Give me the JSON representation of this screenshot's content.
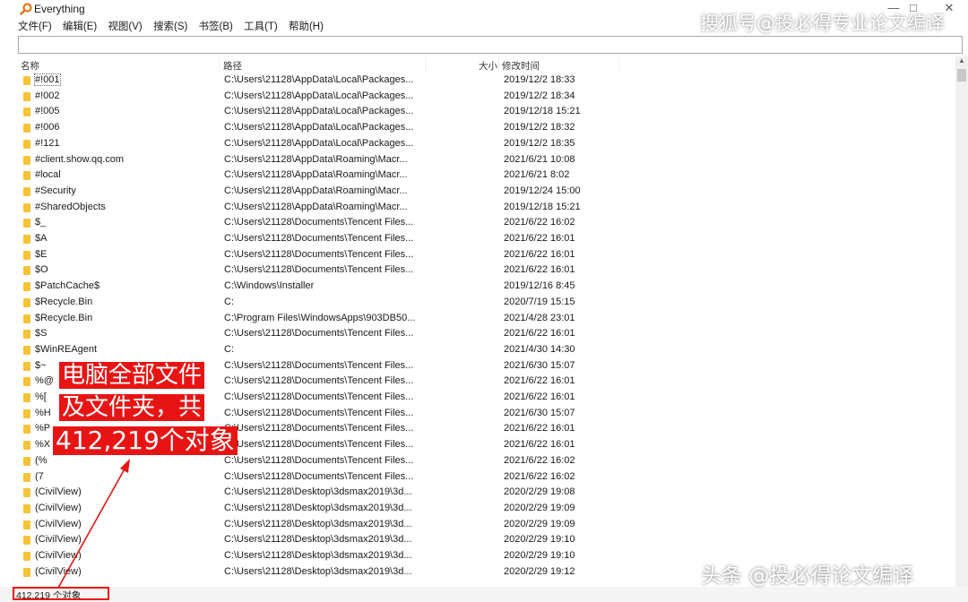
{
  "window": {
    "title": "Everything",
    "minimize": "—",
    "restore": "□",
    "close": "✕"
  },
  "watermarks": {
    "top": "搜狐号@投必得专业论文编译",
    "bottom": "头条 @投必得论文编译"
  },
  "menu": [
    "文件(F)",
    "编辑(E)",
    "视图(V)",
    "搜索(S)",
    "书签(B)",
    "工具(T)",
    "帮助(H)"
  ],
  "search": {
    "value": ""
  },
  "columns": {
    "name": "名称",
    "path": "路径",
    "size": "大小",
    "modified": "修改时间"
  },
  "rows": [
    {
      "name": "#!001",
      "path": "C:\\Users\\21128\\AppData\\Local\\Packages...",
      "time": "2019/12/2 18:33"
    },
    {
      "name": "#!002",
      "path": "C:\\Users\\21128\\AppData\\Local\\Packages...",
      "time": "2019/12/2 18:34"
    },
    {
      "name": "#!005",
      "path": "C:\\Users\\21128\\AppData\\Local\\Packages...",
      "time": "2019/12/18 15:21"
    },
    {
      "name": "#!006",
      "path": "C:\\Users\\21128\\AppData\\Local\\Packages...",
      "time": "2019/12/2 18:32"
    },
    {
      "name": "#!121",
      "path": "C:\\Users\\21128\\AppData\\Local\\Packages...",
      "time": "2019/12/2 18:35"
    },
    {
      "name": "#client.show.qq.com",
      "path": "C:\\Users\\21128\\AppData\\Roaming\\Macr...",
      "time": "2021/6/21 10:08"
    },
    {
      "name": "#local",
      "path": "C:\\Users\\21128\\AppData\\Roaming\\Macr...",
      "time": "2021/6/21 8:02"
    },
    {
      "name": "#Security",
      "path": "C:\\Users\\21128\\AppData\\Roaming\\Macr...",
      "time": "2019/12/24 15:00"
    },
    {
      "name": "#SharedObjects",
      "path": "C:\\Users\\21128\\AppData\\Roaming\\Macr...",
      "time": "2019/12/18 15:21"
    },
    {
      "name": "$_",
      "path": "C:\\Users\\21128\\Documents\\Tencent Files...",
      "time": "2021/6/22 16:02"
    },
    {
      "name": "$A",
      "path": "C:\\Users\\21128\\Documents\\Tencent Files...",
      "time": "2021/6/22 16:01"
    },
    {
      "name": "$E",
      "path": "C:\\Users\\21128\\Documents\\Tencent Files...",
      "time": "2021/6/22 16:01"
    },
    {
      "name": "$O",
      "path": "C:\\Users\\21128\\Documents\\Tencent Files...",
      "time": "2021/6/22 16:01"
    },
    {
      "name": "$PatchCache$",
      "path": "C:\\Windows\\Installer",
      "time": "2019/12/16 8:45"
    },
    {
      "name": "$Recycle.Bin",
      "path": "C:",
      "time": "2020/7/19 15:15"
    },
    {
      "name": "$Recycle.Bin",
      "path": "C:\\Program Files\\WindowsApps\\903DB50...",
      "time": "2021/4/28 23:01"
    },
    {
      "name": "$S",
      "path": "C:\\Users\\21128\\Documents\\Tencent Files...",
      "time": "2021/6/22 16:01"
    },
    {
      "name": "$WinREAgent",
      "path": "C:",
      "time": "2021/4/30 14:30"
    },
    {
      "name": "$~",
      "path": "C:\\Users\\21128\\Documents\\Tencent Files...",
      "time": "2021/6/30 15:07"
    },
    {
      "name": "%@",
      "path": "C:\\Users\\21128\\Documents\\Tencent Files...",
      "time": "2021/6/22 16:01"
    },
    {
      "name": "%[",
      "path": "C:\\Users\\21128\\Documents\\Tencent Files...",
      "time": "2021/6/22 16:01"
    },
    {
      "name": "%H",
      "path": "C:\\Users\\21128\\Documents\\Tencent Files...",
      "time": "2021/6/30 15:07"
    },
    {
      "name": "%P",
      "path": "C:\\Users\\21128\\Documents\\Tencent Files...",
      "time": "2021/6/22 16:01"
    },
    {
      "name": "%X",
      "path": "C:\\Users\\21128\\Documents\\Tencent Files...",
      "time": "2021/6/22 16:01"
    },
    {
      "name": "(%",
      "path": "C:\\Users\\21128\\Documents\\Tencent Files...",
      "time": "2021/6/22 16:02"
    },
    {
      "name": "(7",
      "path": "C:\\Users\\21128\\Documents\\Tencent Files...",
      "time": "2021/6/22 16:02"
    },
    {
      "name": "(CivilView)",
      "path": "C:\\Users\\21128\\Desktop\\3dsmax2019\\3d...",
      "time": "2020/2/29 19:08"
    },
    {
      "name": "(CivilView)",
      "path": "C:\\Users\\21128\\Desktop\\3dsmax2019\\3d...",
      "time": "2020/2/29 19:09"
    },
    {
      "name": "(CivilView)",
      "path": "C:\\Users\\21128\\Desktop\\3dsmax2019\\3d...",
      "time": "2020/2/29 19:09"
    },
    {
      "name": "(CivilView)",
      "path": "C:\\Users\\21128\\Desktop\\3dsmax2019\\3d...",
      "time": "2020/2/29 19:10"
    },
    {
      "name": "(CivilView)",
      "path": "C:\\Users\\21128\\Desktop\\3dsmax2019\\3d...",
      "time": "2020/2/29 19:10"
    },
    {
      "name": "(CivilView)",
      "path": "C:\\Users\\21128\\Desktop\\3dsmax2019\\3d...",
      "time": "2020/2/29 19:12"
    }
  ],
  "annotation": {
    "line1": "电脑全部文件",
    "line2": "及文件夹，共",
    "line3": "412,219个对象",
    "color": "#e81414"
  },
  "status": {
    "text": "412,219 个对象"
  }
}
